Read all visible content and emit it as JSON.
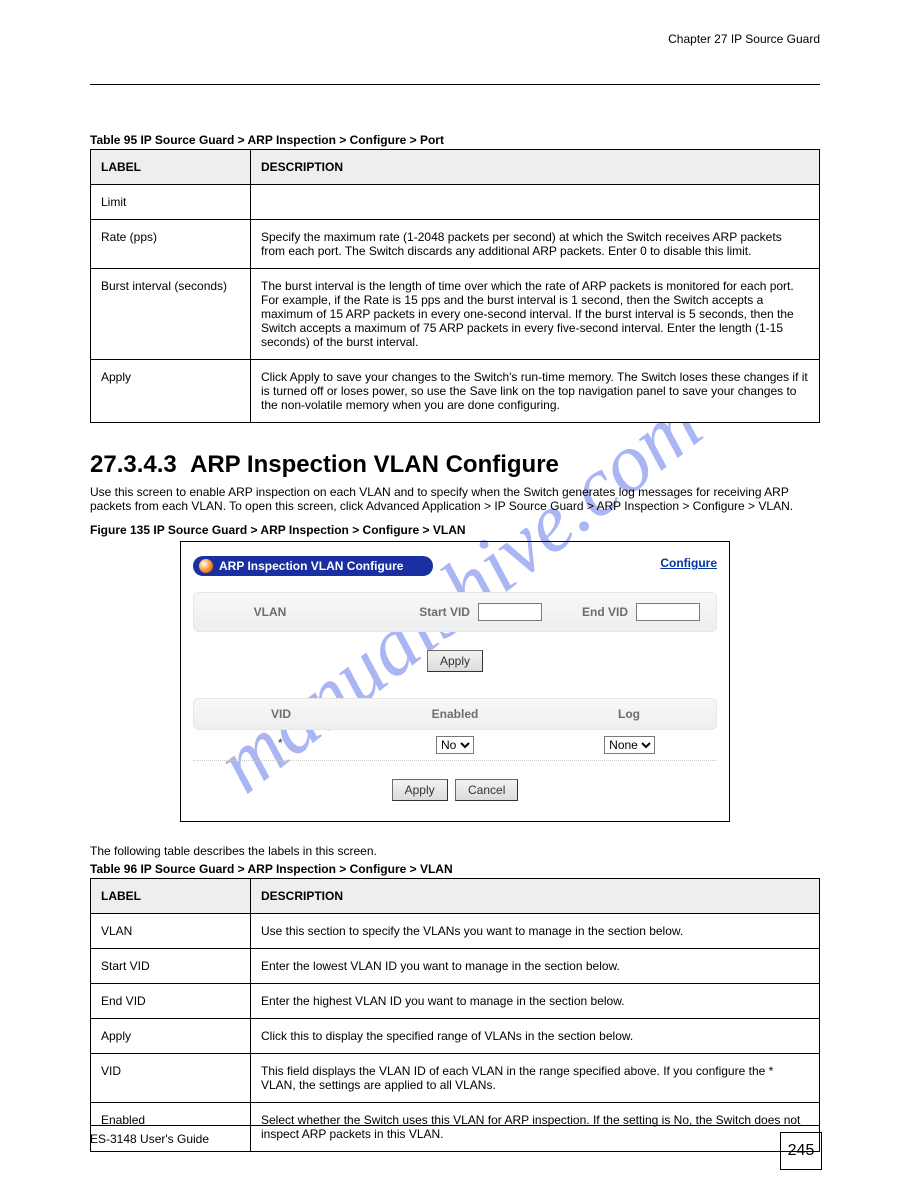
{
  "watermark": "manualshive.com",
  "header_right": "Chapter 27 IP Source Guard",
  "table1": {
    "caption": "Table 95   IP Source Guard > ARP Inspection > Configure > Port",
    "th": {
      "label": "LABEL",
      "desc": "DESCRIPTION"
    },
    "rows": [
      {
        "label": "Limit",
        "desc": ""
      },
      {
        "label": "Rate (pps)",
        "desc": "Specify the maximum rate (1-2048 packets per second) at which the Switch receives\nARP packets from each port. The Switch discards any additional ARP packets. Enter 0\nto disable this limit."
      },
      {
        "label": "Burst interval (seconds)",
        "desc": "The burst interval is the length of time over which the rate of ARP packets is\nmonitored for each port. For example, if the Rate is 15 pps and the burst interval is 1\nsecond, then the Switch accepts a maximum of 15 ARP packets in every one-second\ninterval. If the burst interval is 5 seconds, then the Switch accepts a maximum of 75\nARP packets in every five-second interval.\nEnter the length (1-15 seconds) of the burst interval."
      },
      {
        "label": "Apply",
        "desc": "Click Apply to save your changes to the Switch's run-time memory. The Switch loses\nthese changes if it is turned off or loses power, so use the Save link on the top\nnavigation panel to save your changes to the non-volatile memory when you are done\nconfiguring."
      }
    ]
  },
  "section": {
    "number": "27.3.4.3",
    "title": "ARP Inspection VLAN Configure",
    "sub": "Use this screen to enable ARP inspection on each VLAN and to specify when the Switch\ngenerates log messages for receiving ARP packets from each VLAN. To open this screen,\nclick Advanced Application > IP Source Guard > ARP Inspection > Configure > VLAN."
  },
  "figure": {
    "caption": "Figure 135   IP Source Guard > ARP Inspection > Configure > VLAN",
    "pill": "ARP Inspection VLAN Configure",
    "configure_link": "Configure",
    "vlan_label": "VLAN",
    "start_vid_label": "Start VID",
    "end_vid_label": "End VID",
    "apply": "Apply",
    "cancel": "Cancel",
    "cols": {
      "vid": "VID",
      "enabled": "Enabled",
      "log": "Log"
    },
    "row": {
      "vid": "*",
      "enabled": "No",
      "log": "None"
    }
  },
  "table2": {
    "desc_intro": "The following table describes the labels in this screen.",
    "caption": "Table 96   IP Source Guard > ARP Inspection > Configure > VLAN",
    "th": {
      "label": "LABEL",
      "desc": "DESCRIPTION"
    },
    "rows": [
      {
        "label": "VLAN",
        "desc": "Use this section to specify the VLANs you want to manage in the section below."
      },
      {
        "label": "Start VID",
        "desc": "Enter the lowest VLAN ID you want to manage in the section below."
      },
      {
        "label": "End VID",
        "desc": "Enter the highest VLAN ID you want to manage in the section below."
      },
      {
        "label": "Apply",
        "desc": "Click this to display the specified range of VLANs in the section below."
      },
      {
        "label": "VID",
        "desc": "This field displays the VLAN ID of each VLAN in the range specified above. If you\nconfigure the * VLAN, the settings are applied to all VLANs."
      },
      {
        "label": "Enabled",
        "desc": "Select whether the Switch uses this VLAN for ARP inspection. If the setting is\nNo, the Switch does not inspect ARP packets in this VLAN."
      }
    ]
  },
  "footer": {
    "left": "ES-3148 User's Guide",
    "page": "245"
  }
}
